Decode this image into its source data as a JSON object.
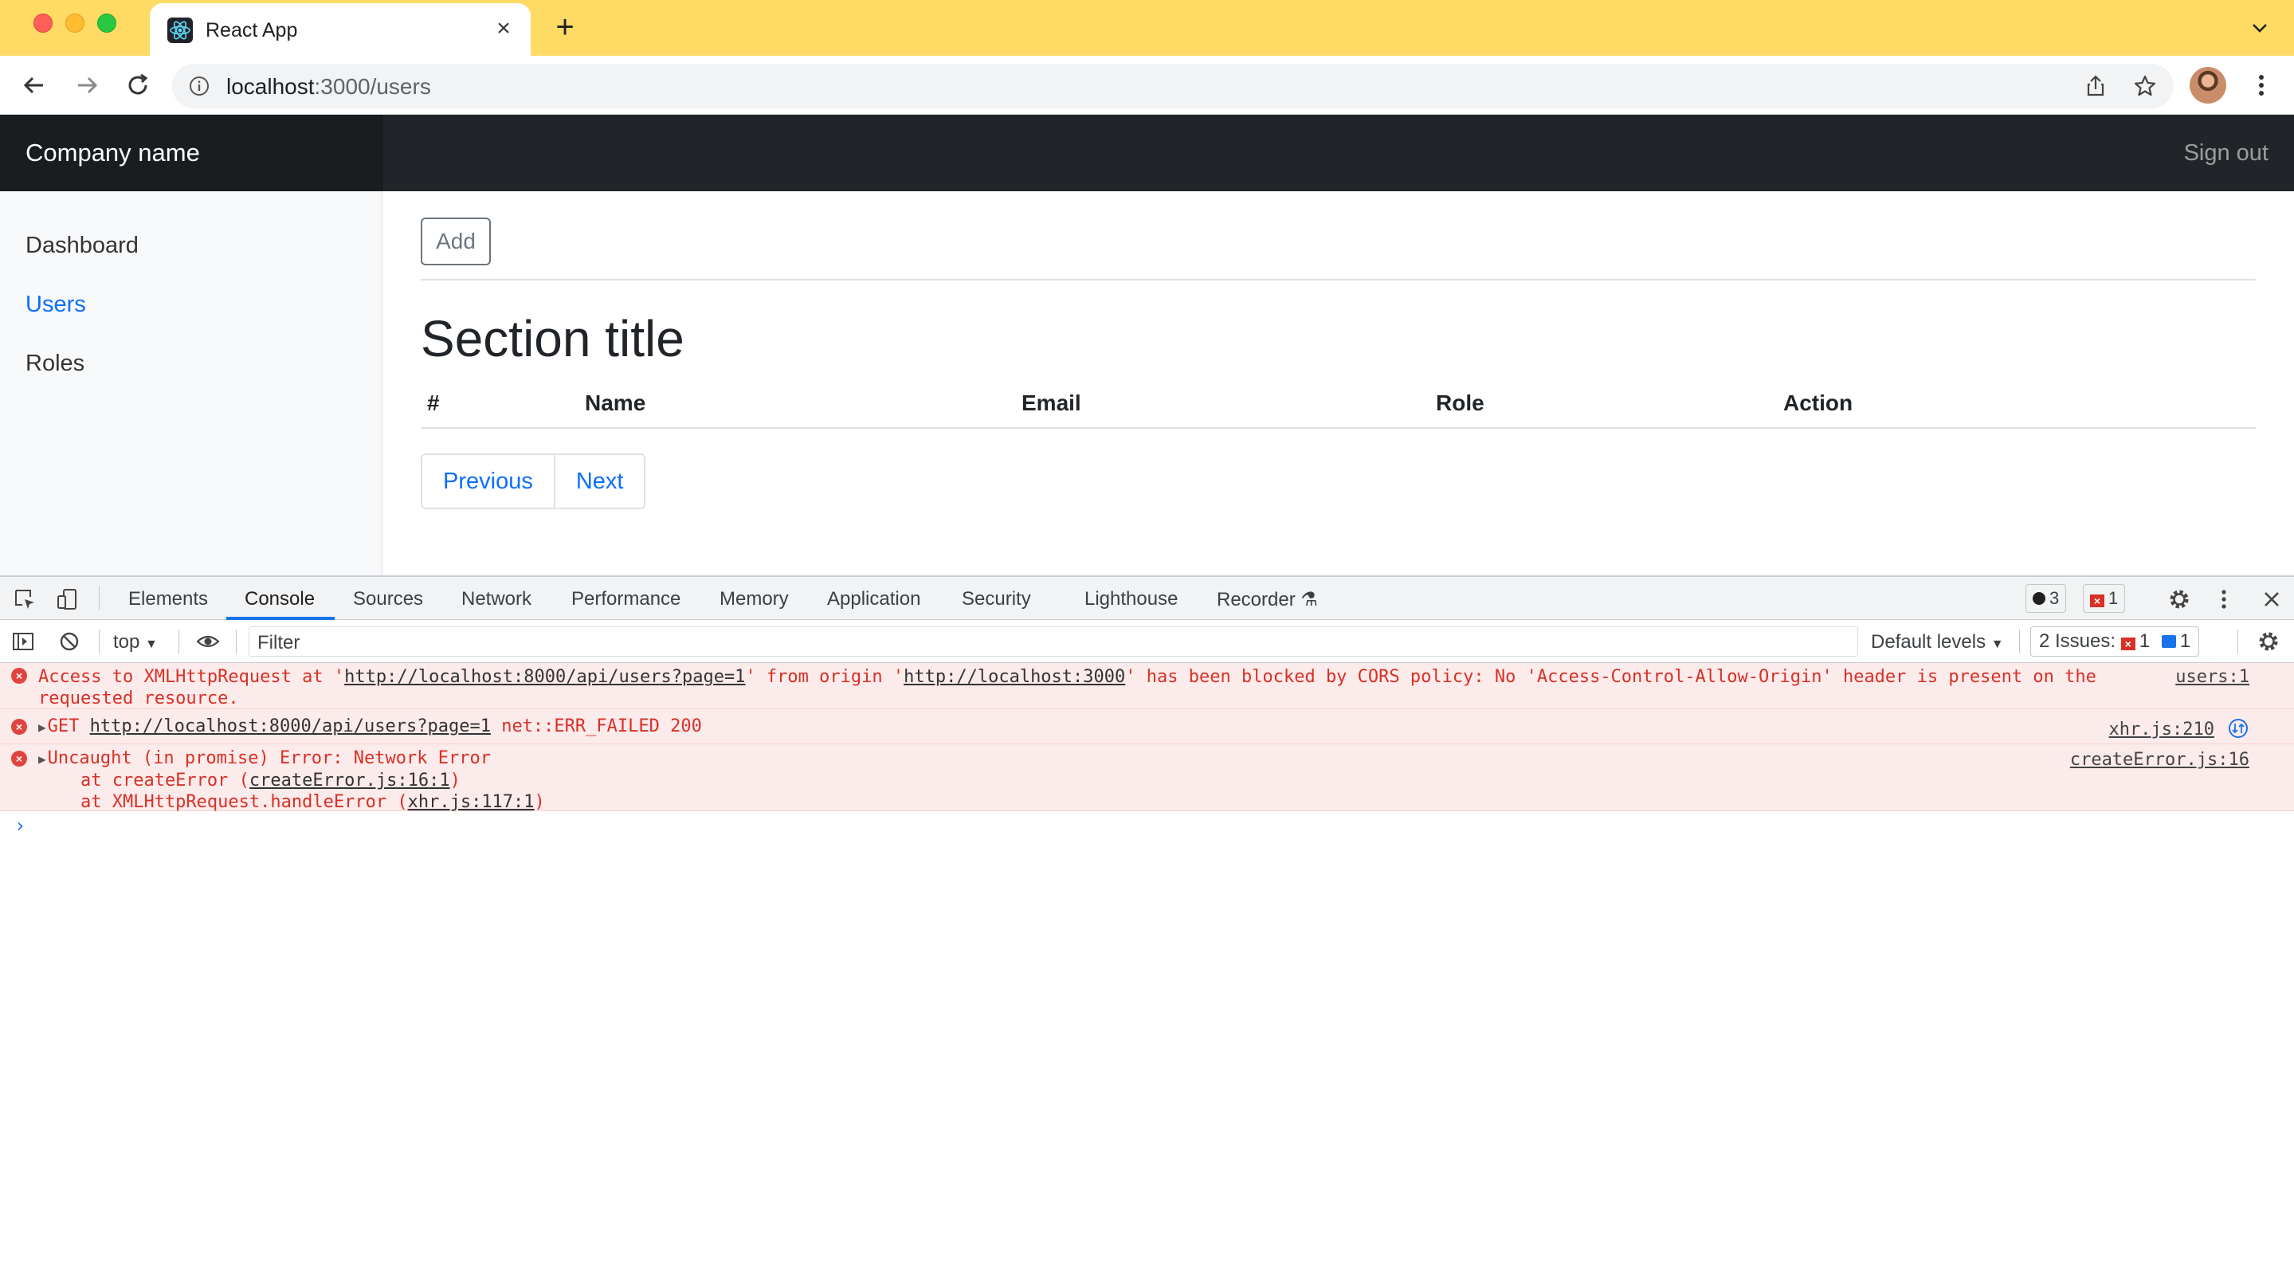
{
  "browser": {
    "tab_title": "React App",
    "url_host": "localhost",
    "url_rest": ":3000/users"
  },
  "app": {
    "brand": "Company name",
    "sign_out": "Sign out",
    "sidebar": [
      {
        "label": "Dashboard",
        "active": false
      },
      {
        "label": "Users",
        "active": true
      },
      {
        "label": "Roles",
        "active": false
      }
    ],
    "add_button": "Add",
    "section_title": "Section title",
    "table_headers": [
      "#",
      "Name",
      "Email",
      "Role",
      "Action"
    ],
    "pagination": {
      "previous": "Previous",
      "next": "Next"
    }
  },
  "devtools": {
    "tabs": [
      "Elements",
      "Console",
      "Sources",
      "Network",
      "Performance",
      "Memory",
      "Application",
      "Security",
      "Lighthouse",
      "Recorder"
    ],
    "active_tab": "Console",
    "message_count": "3",
    "error_count": "1",
    "context": "top",
    "filter_placeholder": "Filter",
    "levels": "Default levels",
    "issues_label": "2 Issues:",
    "issues_errors": "1",
    "issues_info": "1",
    "messages": {
      "cors_1a": "Access to XMLHttpRequest at '",
      "cors_url": "http://localhost:8000/api/users?page=1",
      "cors_1b": "' from origin '",
      "cors_origin": "http://localhost:3000",
      "cors_1c": "' has been blocked by CORS policy: No 'Access-Control-Allow-Origin' header is present on the",
      "cors_2": "requested resource.",
      "cors_src": "users:1",
      "get_prefix": "GET ",
      "get_url": "http://localhost:8000/api/users?page=1",
      "get_suffix": " net::ERR_FAILED 200",
      "get_src": "xhr.js:210",
      "uncaught_1": "Uncaught (in promise) Error: Network Error",
      "uncaught_2a": "    at createError (",
      "uncaught_2_link": "createError.js:16:1",
      "uncaught_2b": ")",
      "uncaught_3a": "    at XMLHttpRequest.handleError (",
      "uncaught_3_link": "xhr.js:117:1",
      "uncaught_3b": ")",
      "uncaught_src": "createError.js:16"
    }
  },
  "colors": {
    "tabstrip": "#ffdb66",
    "navbar": "#212529",
    "link": "#0d6efd",
    "error": "#d93025"
  }
}
